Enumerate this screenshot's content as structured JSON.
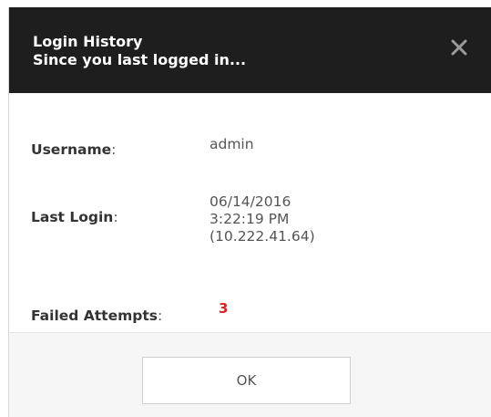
{
  "dialog": {
    "title_line1": "Login History",
    "title_line2": "Since you last logged in...",
    "close_icon": "close-x-icon"
  },
  "fields": {
    "username": {
      "label": "Username",
      "value": "admin"
    },
    "last_login": {
      "label": "Last Login",
      "date": "06/14/2016",
      "time": "3:22:19 PM",
      "ip": "(10.222.41.64)"
    },
    "failed_attempts": {
      "label": "Failed Attempts",
      "value": "3"
    }
  },
  "colon": ":",
  "footer": {
    "ok_label": "OK"
  },
  "colors": {
    "header_bg": "#1e1e1e",
    "failed_value": "#e02020",
    "footer_bg": "#f6f6f6"
  }
}
